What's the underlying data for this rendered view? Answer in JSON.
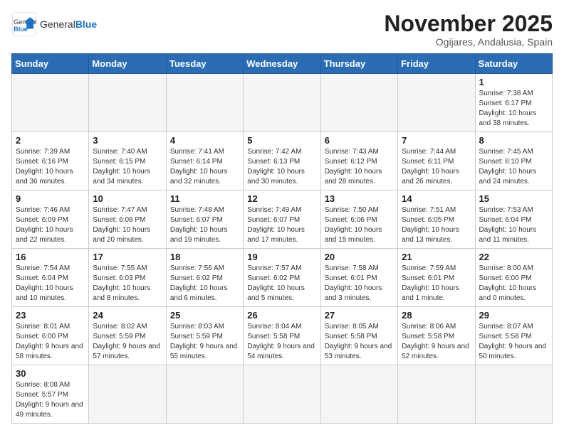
{
  "header": {
    "logo_text_regular": "General",
    "logo_text_bold": "Blue",
    "month_title": "November 2025",
    "location": "Ogijares, Andalusia, Spain"
  },
  "weekdays": [
    "Sunday",
    "Monday",
    "Tuesday",
    "Wednesday",
    "Thursday",
    "Friday",
    "Saturday"
  ],
  "days": [
    {
      "num": "",
      "info": ""
    },
    {
      "num": "",
      "info": ""
    },
    {
      "num": "",
      "info": ""
    },
    {
      "num": "",
      "info": ""
    },
    {
      "num": "",
      "info": ""
    },
    {
      "num": "",
      "info": ""
    },
    {
      "num": "1",
      "info": "Sunrise: 7:38 AM\nSunset: 6:17 PM\nDaylight: 10 hours\nand 38 minutes."
    },
    {
      "num": "2",
      "info": "Sunrise: 7:39 AM\nSunset: 6:16 PM\nDaylight: 10 hours\nand 36 minutes."
    },
    {
      "num": "3",
      "info": "Sunrise: 7:40 AM\nSunset: 6:15 PM\nDaylight: 10 hours\nand 34 minutes."
    },
    {
      "num": "4",
      "info": "Sunrise: 7:41 AM\nSunset: 6:14 PM\nDaylight: 10 hours\nand 32 minutes."
    },
    {
      "num": "5",
      "info": "Sunrise: 7:42 AM\nSunset: 6:13 PM\nDaylight: 10 hours\nand 30 minutes."
    },
    {
      "num": "6",
      "info": "Sunrise: 7:43 AM\nSunset: 6:12 PM\nDaylight: 10 hours\nand 28 minutes."
    },
    {
      "num": "7",
      "info": "Sunrise: 7:44 AM\nSunset: 6:11 PM\nDaylight: 10 hours\nand 26 minutes."
    },
    {
      "num": "8",
      "info": "Sunrise: 7:45 AM\nSunset: 6:10 PM\nDaylight: 10 hours\nand 24 minutes."
    },
    {
      "num": "9",
      "info": "Sunrise: 7:46 AM\nSunset: 6:09 PM\nDaylight: 10 hours\nand 22 minutes."
    },
    {
      "num": "10",
      "info": "Sunrise: 7:47 AM\nSunset: 6:08 PM\nDaylight: 10 hours\nand 20 minutes."
    },
    {
      "num": "11",
      "info": "Sunrise: 7:48 AM\nSunset: 6:07 PM\nDaylight: 10 hours\nand 19 minutes."
    },
    {
      "num": "12",
      "info": "Sunrise: 7:49 AM\nSunset: 6:07 PM\nDaylight: 10 hours\nand 17 minutes."
    },
    {
      "num": "13",
      "info": "Sunrise: 7:50 AM\nSunset: 6:06 PM\nDaylight: 10 hours\nand 15 minutes."
    },
    {
      "num": "14",
      "info": "Sunrise: 7:51 AM\nSunset: 6:05 PM\nDaylight: 10 hours\nand 13 minutes."
    },
    {
      "num": "15",
      "info": "Sunrise: 7:53 AM\nSunset: 6:04 PM\nDaylight: 10 hours\nand 11 minutes."
    },
    {
      "num": "16",
      "info": "Sunrise: 7:54 AM\nSunset: 6:04 PM\nDaylight: 10 hours\nand 10 minutes."
    },
    {
      "num": "17",
      "info": "Sunrise: 7:55 AM\nSunset: 6:03 PM\nDaylight: 10 hours\nand 8 minutes."
    },
    {
      "num": "18",
      "info": "Sunrise: 7:56 AM\nSunset: 6:02 PM\nDaylight: 10 hours\nand 6 minutes."
    },
    {
      "num": "19",
      "info": "Sunrise: 7:57 AM\nSunset: 6:02 PM\nDaylight: 10 hours\nand 5 minutes."
    },
    {
      "num": "20",
      "info": "Sunrise: 7:58 AM\nSunset: 6:01 PM\nDaylight: 10 hours\nand 3 minutes."
    },
    {
      "num": "21",
      "info": "Sunrise: 7:59 AM\nSunset: 6:01 PM\nDaylight: 10 hours\nand 1 minute."
    },
    {
      "num": "22",
      "info": "Sunrise: 8:00 AM\nSunset: 6:00 PM\nDaylight: 10 hours\nand 0 minutes."
    },
    {
      "num": "23",
      "info": "Sunrise: 8:01 AM\nSunset: 6:00 PM\nDaylight: 9 hours\nand 58 minutes."
    },
    {
      "num": "24",
      "info": "Sunrise: 8:02 AM\nSunset: 5:59 PM\nDaylight: 9 hours\nand 57 minutes."
    },
    {
      "num": "25",
      "info": "Sunrise: 8:03 AM\nSunset: 5:59 PM\nDaylight: 9 hours\nand 55 minutes."
    },
    {
      "num": "26",
      "info": "Sunrise: 8:04 AM\nSunset: 5:58 PM\nDaylight: 9 hours\nand 54 minutes."
    },
    {
      "num": "27",
      "info": "Sunrise: 8:05 AM\nSunset: 5:58 PM\nDaylight: 9 hours\nand 53 minutes."
    },
    {
      "num": "28",
      "info": "Sunrise: 8:06 AM\nSunset: 5:58 PM\nDaylight: 9 hours\nand 52 minutes."
    },
    {
      "num": "29",
      "info": "Sunrise: 8:07 AM\nSunset: 5:58 PM\nDaylight: 9 hours\nand 50 minutes."
    },
    {
      "num": "30",
      "info": "Sunrise: 8:08 AM\nSunset: 5:57 PM\nDaylight: 9 hours\nand 49 minutes."
    },
    {
      "num": "",
      "info": ""
    },
    {
      "num": "",
      "info": ""
    },
    {
      "num": "",
      "info": ""
    },
    {
      "num": "",
      "info": ""
    },
    {
      "num": "",
      "info": ""
    },
    {
      "num": "",
      "info": ""
    }
  ]
}
